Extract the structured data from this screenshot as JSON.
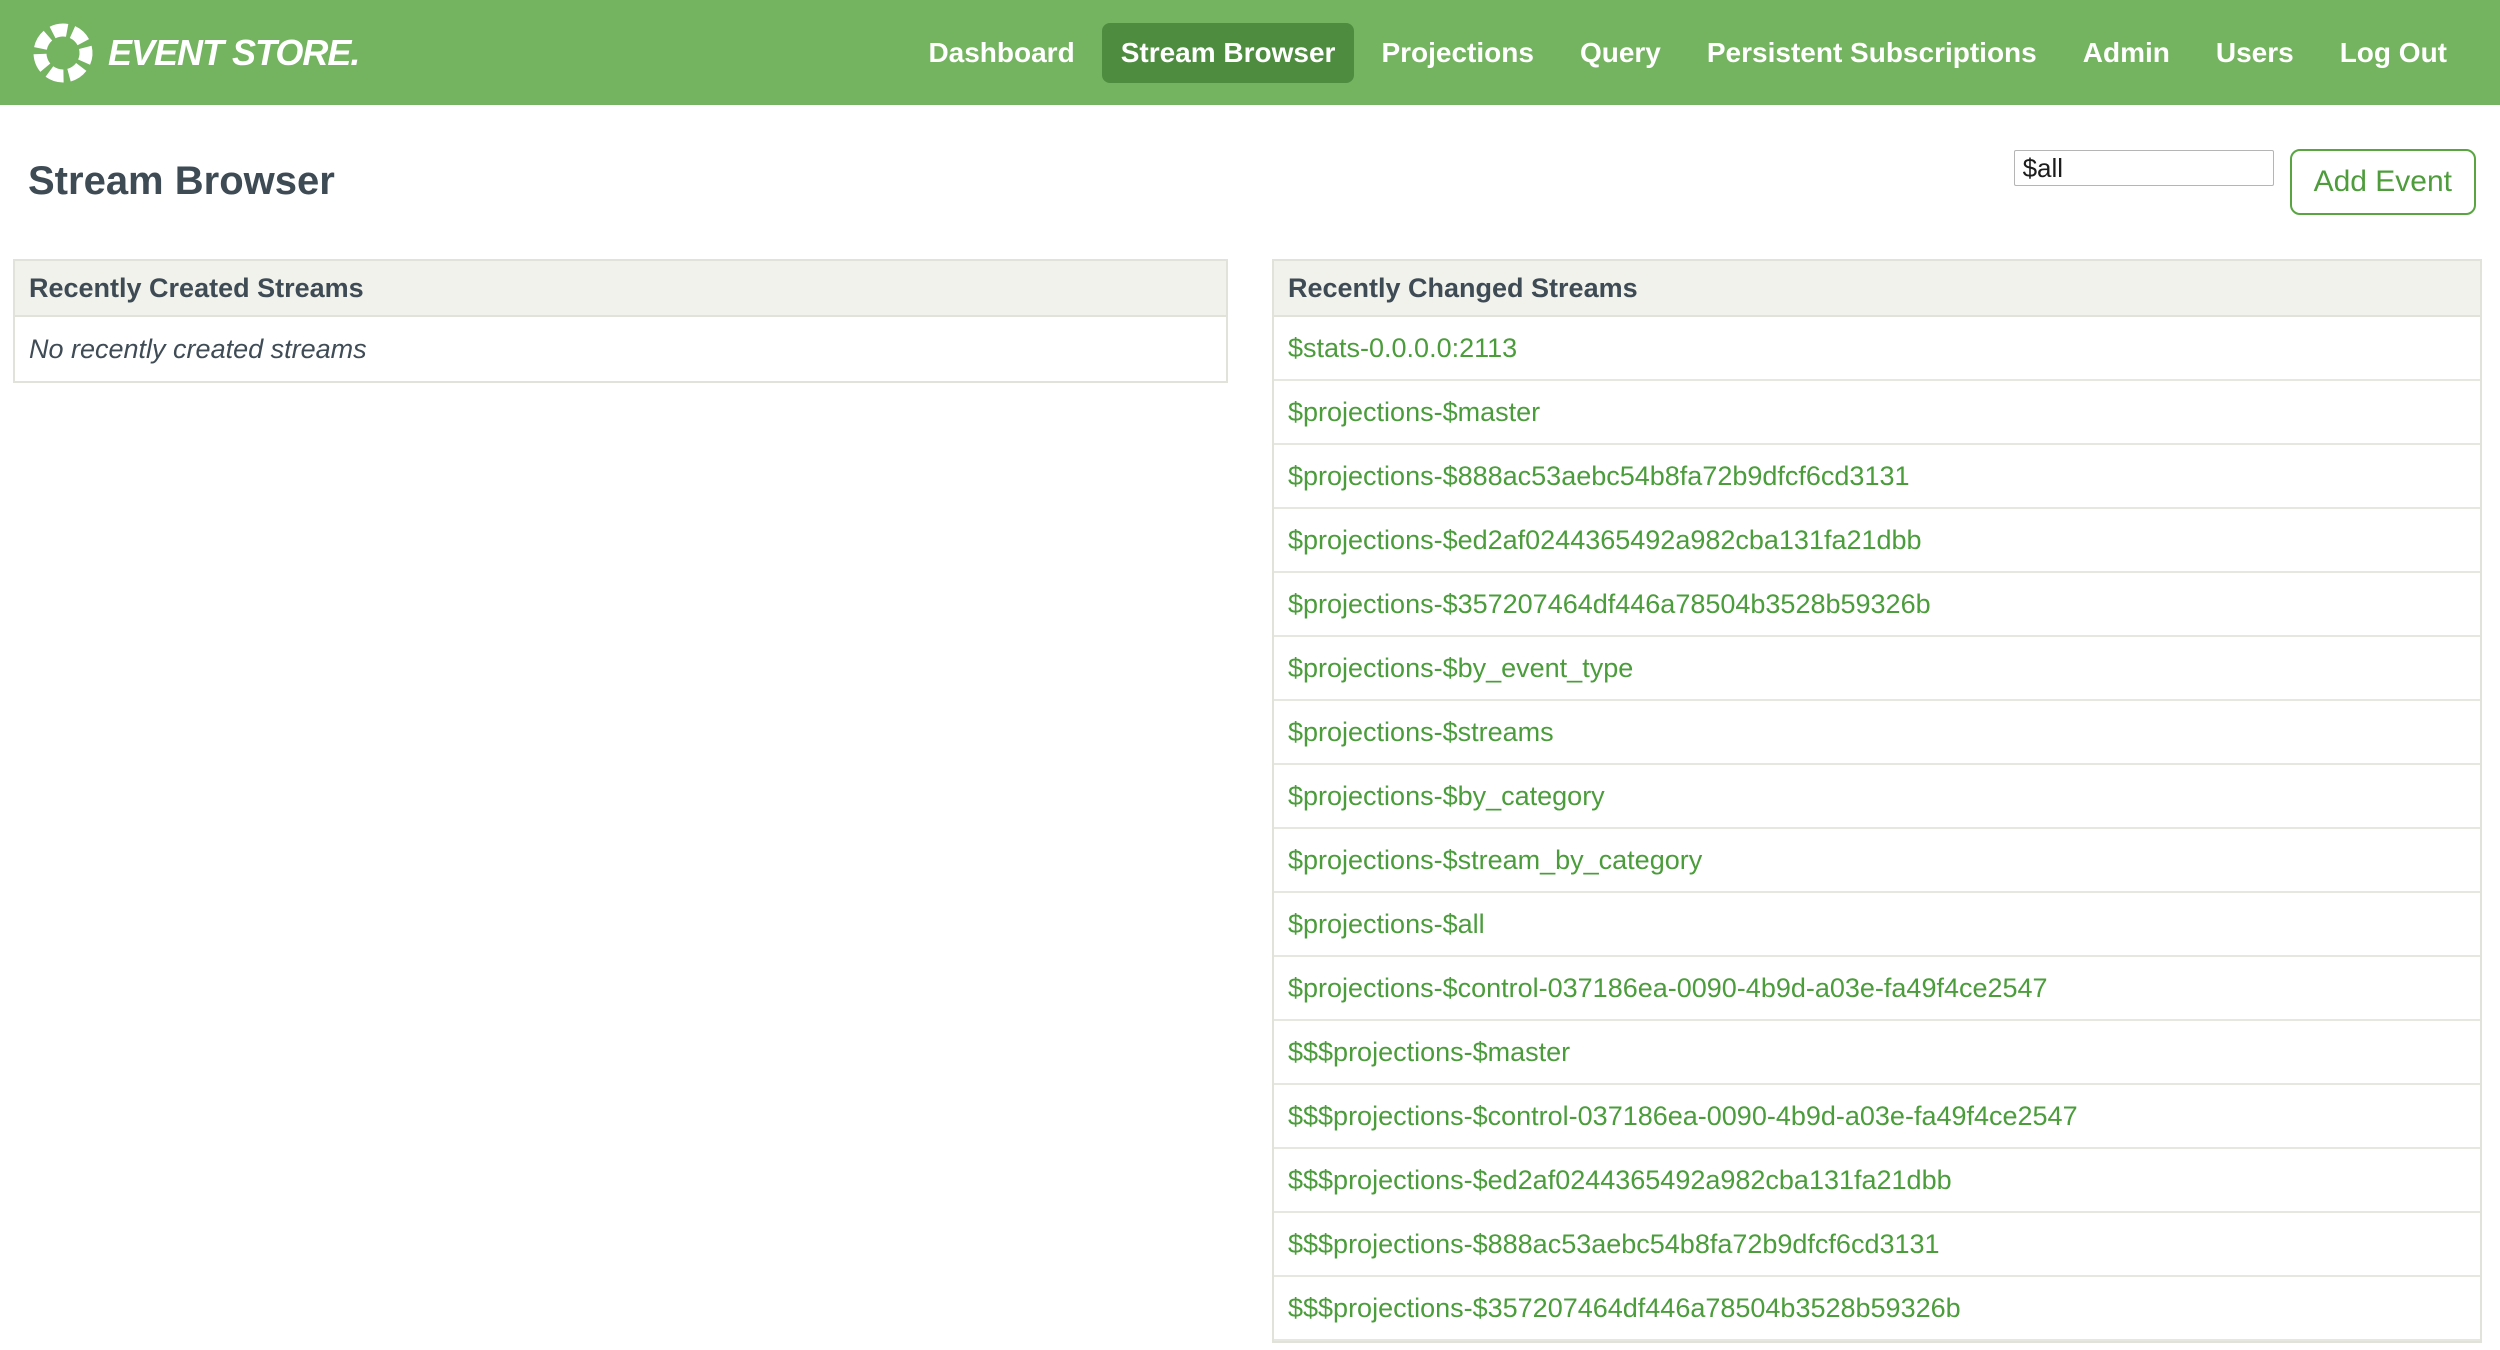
{
  "header": {
    "logo_text": "EVENT STORE.",
    "nav": [
      {
        "label": "Dashboard",
        "active": false
      },
      {
        "label": "Stream Browser",
        "active": true
      },
      {
        "label": "Projections",
        "active": false
      },
      {
        "label": "Query",
        "active": false
      },
      {
        "label": "Persistent Subscriptions",
        "active": false
      },
      {
        "label": "Admin",
        "active": false
      },
      {
        "label": "Users",
        "active": false
      },
      {
        "label": "Log Out",
        "active": false
      }
    ]
  },
  "page": {
    "title": "Stream Browser",
    "stream_input_value": "$all",
    "add_event_label": "Add Event"
  },
  "panels": {
    "created": {
      "title": "Recently Created Streams",
      "empty_message": "No recently created streams"
    },
    "changed": {
      "title": "Recently Changed Streams",
      "streams": [
        "$stats-0.0.0.0:2113",
        "$projections-$master",
        "$projections-$888ac53aebc54b8fa72b9dfcf6cd3131",
        "$projections-$ed2af0244365492a982cba131fa21dbb",
        "$projections-$357207464df446a78504b3528b59326b",
        "$projections-$by_event_type",
        "$projections-$streams",
        "$projections-$by_category",
        "$projections-$stream_by_category",
        "$projections-$all",
        "$projections-$control-037186ea-0090-4b9d-a03e-fa49f4ce2547",
        "$$$projections-$master",
        "$$$projections-$control-037186ea-0090-4b9d-a03e-fa49f4ce2547",
        "$$$projections-$ed2af0244365492a982cba131fa21dbb",
        "$$$projections-$888ac53aebc54b8fa72b9dfcf6cd3131",
        "$$$projections-$357207464df446a78504b3528b59326b"
      ]
    }
  },
  "colors": {
    "header_green": "#74b35f",
    "active_tab_green": "#4e8c3f",
    "link_green": "#4b9c3b",
    "button_green": "#58a542",
    "heading_slate": "#3e4b55",
    "panel_header_bg": "#f1f2ec",
    "panel_border": "#e1e3db"
  }
}
